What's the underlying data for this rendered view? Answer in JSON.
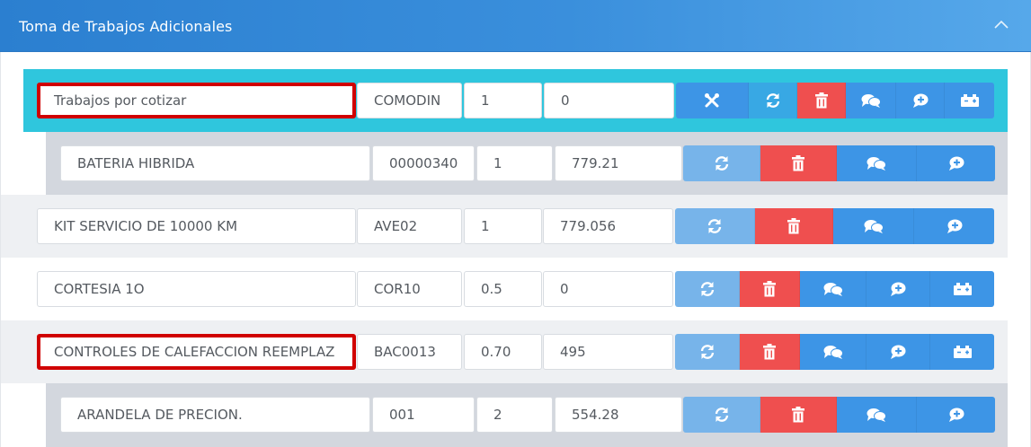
{
  "panel": {
    "title": "Toma de Trabajos Adicionales"
  },
  "colors": {
    "header": "#3a8fdc",
    "highlight_row": "#2fc6dd",
    "sub_row": "#d3d7de",
    "alt_row": "#eef0f3",
    "btn_blue": "#3d95e6",
    "btn_light": "#77b4ea",
    "btn_red": "#ef4f4f",
    "error_border": "#d00000"
  },
  "rows": [
    {
      "description": "Trabajos por cotizar",
      "code": "COMODIN",
      "qty": "1",
      "price": "0",
      "buttons": [
        "wrench-icon",
        "refresh-icon",
        "trash-icon",
        "comments-icon",
        "comment-plus-icon",
        "battery-icon"
      ]
    },
    {
      "description": "BATERIA HIBRIDA",
      "code": "00000340",
      "qty": "1",
      "price": "779.21",
      "buttons": [
        "refresh-icon",
        "trash-icon",
        "comments-icon",
        "comment-plus-icon"
      ]
    },
    {
      "description": "KIT SERVICIO DE 10000 KM",
      "code": "AVE02",
      "qty": "1",
      "price": "779.056",
      "buttons": [
        "refresh-icon",
        "trash-icon",
        "comments-icon",
        "comment-plus-icon"
      ]
    },
    {
      "description": "CORTESIA 1O",
      "code": "COR10",
      "qty": "0.5",
      "price": "0",
      "buttons": [
        "refresh-icon",
        "trash-icon",
        "comments-icon",
        "comment-plus-icon",
        "battery-icon"
      ]
    },
    {
      "description": "CONTROLES DE CALEFACCION REEMPLAZ",
      "code": "BAC0013",
      "qty": "0.70",
      "price": "495",
      "buttons": [
        "refresh-icon",
        "trash-icon",
        "comments-icon",
        "comment-plus-icon",
        "battery-icon"
      ]
    },
    {
      "description": "ARANDELA DE PRECION.",
      "code": "001",
      "qty": "2",
      "price": "554.28",
      "buttons": [
        "refresh-icon",
        "trash-icon",
        "comments-icon",
        "comment-plus-icon"
      ]
    }
  ]
}
